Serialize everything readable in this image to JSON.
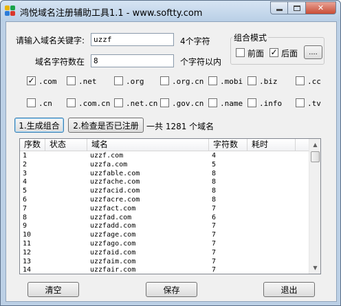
{
  "window": {
    "title": "鸿悦域名注册辅助工具1.1 - www.softty.com"
  },
  "keyword": {
    "label": "请输入域名关键字:",
    "value": "uzzf",
    "hint": "4个字符"
  },
  "length": {
    "label": "域名字符数在",
    "value": "8",
    "hint": "个字符以内"
  },
  "combo": {
    "title": "组合模式",
    "front_label": "前面",
    "front_checked": false,
    "back_label": "后面",
    "back_checked": true,
    "more_label": "...."
  },
  "tlds_row1": [
    {
      "label": ".com",
      "checked": true
    },
    {
      "label": ".net",
      "checked": false
    },
    {
      "label": ".org",
      "checked": false
    },
    {
      "label": ".org.cn",
      "checked": false
    },
    {
      "label": ".mobi",
      "checked": false
    },
    {
      "label": ".biz",
      "checked": false
    },
    {
      "label": ".cc",
      "checked": false
    }
  ],
  "tlds_row2": [
    {
      "label": ".cn",
      "checked": false
    },
    {
      "label": ".com.cn",
      "checked": false
    },
    {
      "label": ".net.cn",
      "checked": false
    },
    {
      "label": ".gov.cn",
      "checked": false
    },
    {
      "label": ".name",
      "checked": false
    },
    {
      "label": ".info",
      "checked": false
    },
    {
      "label": ".tv",
      "checked": false
    }
  ],
  "actions": {
    "generate_label": "1.生成组合",
    "check_label": "2.检查是否已注册",
    "summary": "一共 1281 个域名"
  },
  "table": {
    "columns": [
      "序数",
      "状态",
      "域名",
      "字符数",
      "耗时"
    ],
    "rows": [
      [
        "1",
        "",
        "uzzf.com",
        "4",
        ""
      ],
      [
        "2",
        "",
        "uzzfa.com",
        "5",
        ""
      ],
      [
        "3",
        "",
        "uzzfable.com",
        "8",
        ""
      ],
      [
        "4",
        "",
        "uzzfache.com",
        "8",
        ""
      ],
      [
        "5",
        "",
        "uzzfacid.com",
        "8",
        ""
      ],
      [
        "6",
        "",
        "uzzfacre.com",
        "8",
        ""
      ],
      [
        "7",
        "",
        "uzzfact.com",
        "7",
        ""
      ],
      [
        "8",
        "",
        "uzzfad.com",
        "6",
        ""
      ],
      [
        "9",
        "",
        "uzzfadd.com",
        "7",
        ""
      ],
      [
        "10",
        "",
        "uzzfage.com",
        "7",
        ""
      ],
      [
        "11",
        "",
        "uzzfago.com",
        "7",
        ""
      ],
      [
        "12",
        "",
        "uzzfaid.com",
        "7",
        ""
      ],
      [
        "13",
        "",
        "uzzfaim.com",
        "7",
        ""
      ],
      [
        "14",
        "",
        "uzzfair.com",
        "7",
        ""
      ]
    ]
  },
  "footer": {
    "clear_label": "清空",
    "save_label": "保存",
    "exit_label": "退出"
  }
}
